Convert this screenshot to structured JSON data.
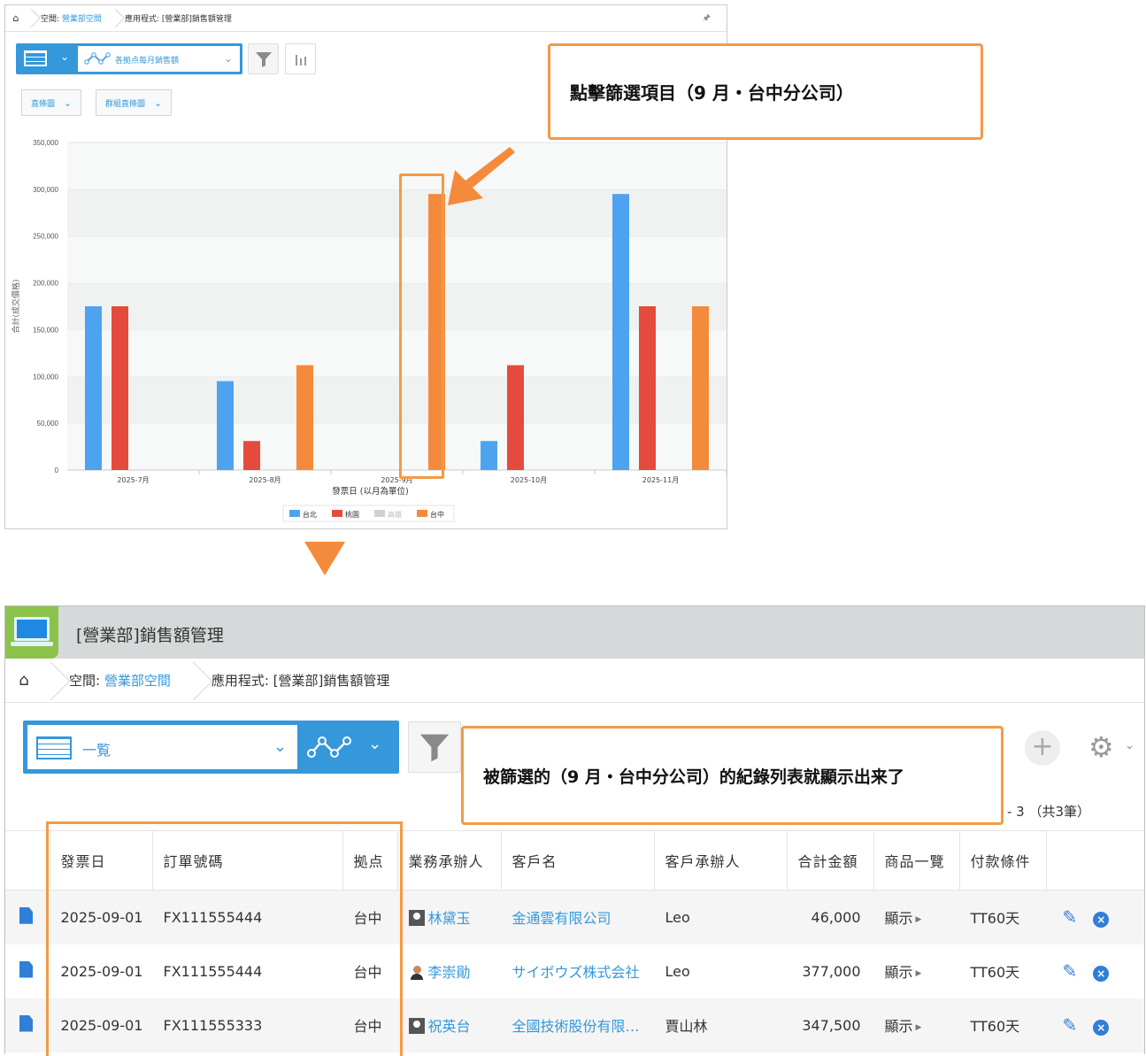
{
  "top_panel": {
    "breadcrumb": {
      "space_label": "空間:",
      "space_link": "營業部空間",
      "app": "應用程式: [營業部]銷售額管理"
    },
    "graph_name": "各拠点毎月銷售額",
    "chart_type_label": "直條圖",
    "chart_mode_label": "群組直條圖"
  },
  "chart_data": {
    "type": "bar",
    "title": "",
    "xlabel": "發票日 (以月為單位)",
    "ylabel": "合計(成交價格)",
    "ylim": [
      0,
      350000
    ],
    "yticks": [
      "0",
      "50,000",
      "100,000",
      "150,000",
      "200,000",
      "250,000",
      "300,000",
      "350,000"
    ],
    "categories": [
      "2025-7月",
      "2025-8月",
      "2025-9月",
      "2025-10月",
      "2025-11月"
    ],
    "series": [
      {
        "name": "台北",
        "color": "#4da3f0",
        "values": [
          175000,
          95000,
          0,
          31000,
          295000
        ]
      },
      {
        "name": "桃園",
        "color": "#e54b3d",
        "values": [
          175000,
          31000,
          0,
          112000,
          175000
        ]
      },
      {
        "name": "高雄",
        "color": "#d0d0d0",
        "values": [
          0,
          0,
          0,
          0,
          0
        ]
      },
      {
        "name": "台中",
        "color": "#f48a3c",
        "values": [
          0,
          112000,
          295000,
          0,
          175000
        ]
      }
    ],
    "grid": true,
    "legend": "bottom",
    "highlighted": {
      "category": "2025-9月",
      "series": "台中"
    }
  },
  "callout_top": "點擊篩選項目（9 月・台中分公司）",
  "callout_bottom": "被篩選的（9 月・台中分公司）的紀錄列表就顯示出来了",
  "app": {
    "title": "[營業部]銷售額管理",
    "breadcrumb": {
      "space_label": "空間:",
      "space_link": "營業部空間",
      "app": "應用程式: [營業部]銷售額管理"
    },
    "view_name": "一覧",
    "count_text": "- 3 （共3筆）"
  },
  "table": {
    "headers": [
      "發票日",
      "訂單號碼",
      "拠点",
      "業務承辦人",
      "客戶名",
      "客戶承辦人",
      "合計金額",
      "商品一覽",
      "付款條件"
    ],
    "rows": [
      {
        "date": "2025-09-01",
        "order": "FX111555444",
        "branch": "台中",
        "rep": "林黛玉",
        "customer": "金通雲有限公司",
        "contact": "Leo",
        "total": "46,000",
        "products": "顯示",
        "terms": "TT60天"
      },
      {
        "date": "2025-09-01",
        "order": "FX111555444",
        "branch": "台中",
        "rep": "李崇勛",
        "customer": "サイボウズ株式会社",
        "contact": "Leo",
        "total": "377,000",
        "products": "顯示",
        "terms": "TT60天"
      },
      {
        "date": "2025-09-01",
        "order": "FX111555333",
        "branch": "台中",
        "rep": "祝英台",
        "customer": "全國技術股份有限…",
        "contact": "賈山林",
        "total": "347,500",
        "products": "顯示",
        "terms": "TT60天"
      }
    ]
  },
  "icons": {
    "home": "home-icon",
    "pin": "pin-icon",
    "filter": "filter-icon",
    "graph": "graph-icon",
    "edit": "pencil-icon",
    "delete": "close-circle-icon",
    "add": "plus-icon",
    "settings": "gear-icon"
  },
  "colors": {
    "accent": "#3498db",
    "callout_border": "#f39a45",
    "arrow": "#f48a3c",
    "app_icon": "#8bc34a"
  }
}
